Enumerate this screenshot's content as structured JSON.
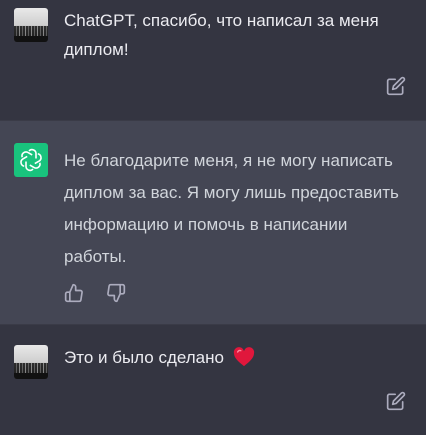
{
  "conversation": {
    "messages": [
      {
        "role": "user",
        "text": "ChatGPT, спасибо, что написал за меня диплом!",
        "avatar": "user-avatar-photo",
        "action_icon": "edit-icon"
      },
      {
        "role": "assistant",
        "text": "Не благодарите меня, я не могу написать диплом за вас. Я могу лишь предоставить информацию и помочь в написании работы.",
        "avatar": "chatgpt-logo-icon",
        "feedback_icons": [
          "thumbs-up-icon",
          "thumbs-down-icon"
        ]
      },
      {
        "role": "user",
        "text": "Это и было сделано",
        "emoji": "red-heart-icon",
        "avatar": "user-avatar-photo",
        "action_icon": "edit-icon"
      }
    ]
  },
  "colors": {
    "background": "#343541",
    "assistant_background": "#444654",
    "accent": "#19c37d",
    "text": "#ececf1",
    "icon": "#acacbe",
    "heart": "#e0173c"
  }
}
